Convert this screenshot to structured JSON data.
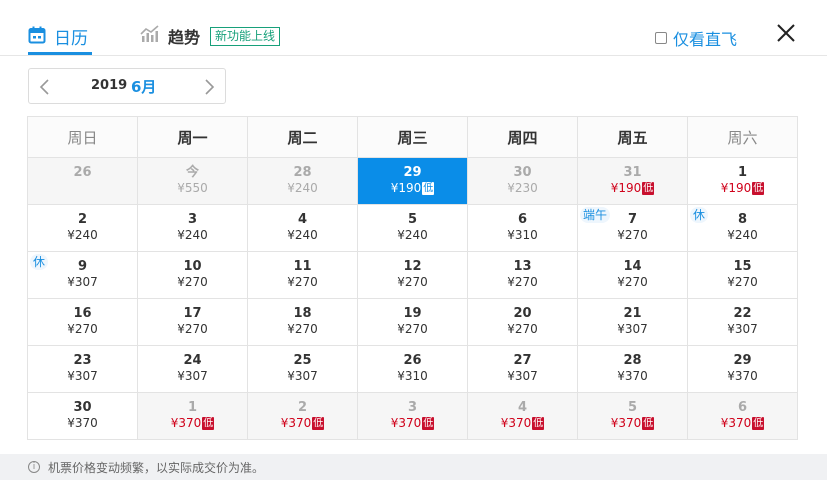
{
  "tabs": {
    "calendar_label": "日历",
    "trend_label": "趋势",
    "new_badge": "新功能上线"
  },
  "direct_only_label": "仅看直飞",
  "month_selector": {
    "year": "2019",
    "month": "6月"
  },
  "weekdays": [
    "周日",
    "周一",
    "周二",
    "周三",
    "周四",
    "周五",
    "周六"
  ],
  "low_tag": "低",
  "weeks": [
    [
      {
        "day": "26",
        "price": "",
        "state": "muted"
      },
      {
        "day": "今",
        "price": "¥550",
        "state": "muted"
      },
      {
        "day": "28",
        "price": "¥240",
        "state": "muted"
      },
      {
        "day": "29",
        "price": "¥190",
        "state": "selected",
        "low": true
      },
      {
        "day": "30",
        "price": "¥230",
        "state": "muted"
      },
      {
        "day": "31",
        "price": "¥190",
        "state": "muted",
        "low": true
      },
      {
        "day": "1",
        "price": "¥190",
        "state": "normal",
        "low": true
      }
    ],
    [
      {
        "day": "2",
        "price": "¥240",
        "state": "normal"
      },
      {
        "day": "3",
        "price": "¥240",
        "state": "normal"
      },
      {
        "day": "4",
        "price": "¥240",
        "state": "normal"
      },
      {
        "day": "5",
        "price": "¥240",
        "state": "normal"
      },
      {
        "day": "6",
        "price": "¥310",
        "state": "normal"
      },
      {
        "day": "7",
        "price": "¥270",
        "state": "normal",
        "holiday": "端午"
      },
      {
        "day": "8",
        "price": "¥240",
        "state": "normal",
        "holiday": "休"
      }
    ],
    [
      {
        "day": "9",
        "price": "¥307",
        "state": "normal",
        "holiday": "休"
      },
      {
        "day": "10",
        "price": "¥270",
        "state": "normal"
      },
      {
        "day": "11",
        "price": "¥270",
        "state": "normal"
      },
      {
        "day": "12",
        "price": "¥270",
        "state": "normal"
      },
      {
        "day": "13",
        "price": "¥270",
        "state": "normal"
      },
      {
        "day": "14",
        "price": "¥270",
        "state": "normal"
      },
      {
        "day": "15",
        "price": "¥270",
        "state": "normal"
      }
    ],
    [
      {
        "day": "16",
        "price": "¥270",
        "state": "normal"
      },
      {
        "day": "17",
        "price": "¥270",
        "state": "normal"
      },
      {
        "day": "18",
        "price": "¥270",
        "state": "normal"
      },
      {
        "day": "19",
        "price": "¥270",
        "state": "normal"
      },
      {
        "day": "20",
        "price": "¥270",
        "state": "normal"
      },
      {
        "day": "21",
        "price": "¥307",
        "state": "normal"
      },
      {
        "day": "22",
        "price": "¥307",
        "state": "normal"
      }
    ],
    [
      {
        "day": "23",
        "price": "¥307",
        "state": "normal"
      },
      {
        "day": "24",
        "price": "¥307",
        "state": "normal"
      },
      {
        "day": "25",
        "price": "¥307",
        "state": "normal"
      },
      {
        "day": "26",
        "price": "¥310",
        "state": "normal"
      },
      {
        "day": "27",
        "price": "¥307",
        "state": "normal"
      },
      {
        "day": "28",
        "price": "¥370",
        "state": "normal"
      },
      {
        "day": "29",
        "price": "¥370",
        "state": "normal"
      }
    ],
    [
      {
        "day": "30",
        "price": "¥370",
        "state": "normal"
      },
      {
        "day": "1",
        "price": "¥370",
        "state": "muted",
        "low": true
      },
      {
        "day": "2",
        "price": "¥370",
        "state": "muted",
        "low": true
      },
      {
        "day": "3",
        "price": "¥370",
        "state": "muted",
        "low": true
      },
      {
        "day": "4",
        "price": "¥370",
        "state": "muted",
        "low": true
      },
      {
        "day": "5",
        "price": "¥370",
        "state": "muted",
        "low": true
      },
      {
        "day": "6",
        "price": "¥370",
        "state": "muted",
        "low": true
      }
    ]
  ],
  "footer_note": "机票价格变动频繁，以实际成交价为准。",
  "icons": {
    "calendar": "calendar-icon",
    "trend": "trend-chart-icon",
    "close": "close-icon",
    "prev": "chevron-left-icon",
    "next": "chevron-right-icon",
    "info": "info-icon"
  },
  "colors": {
    "accent": "#1a8fe0",
    "selected": "#0a8de8",
    "low_price": "#d0021b",
    "badge_green": "#17a07a"
  }
}
